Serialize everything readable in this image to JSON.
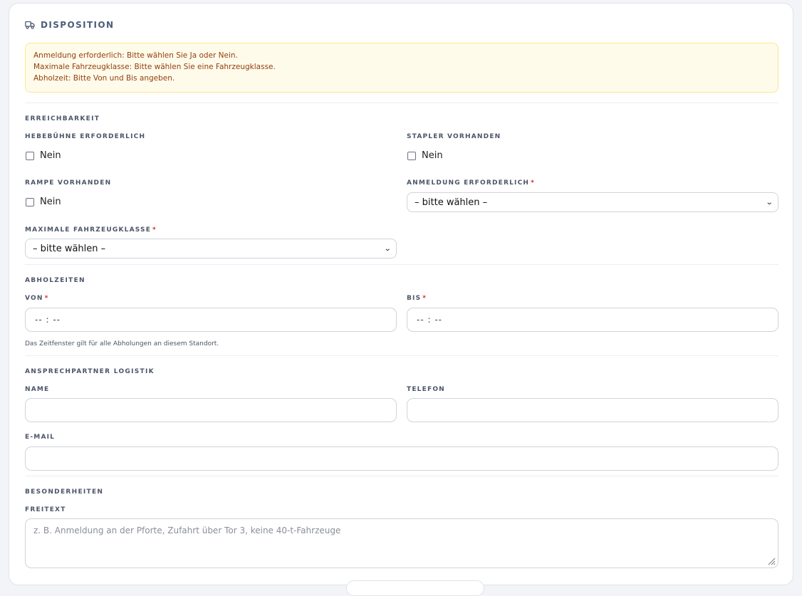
{
  "header": {
    "title": "DISPOSITION",
    "icon": "truck-icon"
  },
  "alert": {
    "lines": [
      "Anmeldung erforderlich: Bitte wählen Sie Ja oder Nein.",
      "Maximale Fahrzeugklasse: Bitte wählen Sie eine Fahrzeugklasse.",
      "Abholzeit: Bitte Von und Bis angeben."
    ],
    "colors": {
      "background": "#fffbeb",
      "border": "#fde68a",
      "text": "#92400e"
    }
  },
  "erreichbarkeit": {
    "title": "ERREICHBARKEIT",
    "hebebuehne": {
      "label": "HEBEBÜHNE ERFORDERLICH",
      "option": "Nein",
      "checked": false
    },
    "stapler": {
      "label": "STAPLER VORHANDEN",
      "option": "Nein",
      "checked": false
    },
    "rampe": {
      "label": "RAMPE VORHANDEN",
      "option": "Nein",
      "checked": false
    },
    "anmeldung": {
      "label": "ANMELDUNG ERFORDERLICH",
      "required": "*",
      "value": "– bitte wählen –"
    },
    "fahrzeugklasse": {
      "label": "MAXIMALE FAHRZEUGKLASSE",
      "required": "*",
      "value": "– bitte wählen –"
    }
  },
  "abholzeiten": {
    "title": "ABHOLZEITEN",
    "von": {
      "label": "VON",
      "required": "*",
      "value": "-- : --"
    },
    "bis": {
      "label": "BIS",
      "required": "*",
      "value": "-- : --"
    },
    "hint": "Das Zeitfenster gilt für alle Abholungen an diesem Standort."
  },
  "ansprechpartner": {
    "title": "ANSPRECHPARTNER LOGISTIK",
    "name": {
      "label": "NAME",
      "value": ""
    },
    "telefon": {
      "label": "TELEFON",
      "value": ""
    },
    "email": {
      "label": "E-MAIL",
      "value": ""
    }
  },
  "besonderheiten": {
    "title": "BESONDERHEITEN",
    "freitext": {
      "label": "FREITEXT",
      "placeholder": "z. B. Anmeldung an der Pforte, Zufahrt über Tor 3, keine 40-t-Fahrzeuge"
    }
  },
  "colors": {
    "required": "#dc2626",
    "accent": "#4b5d7a"
  }
}
